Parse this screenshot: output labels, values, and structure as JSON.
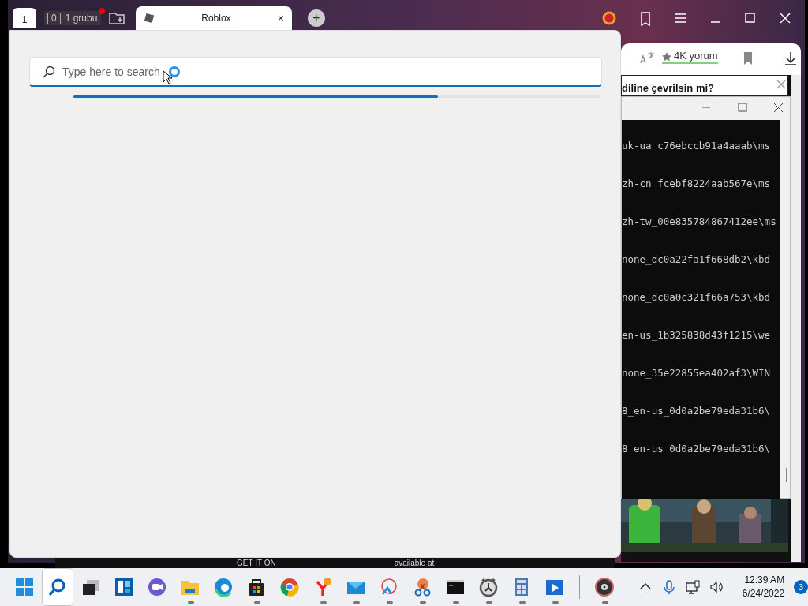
{
  "browser": {
    "home_badge": "1",
    "group_count": "0",
    "group_label": "1 grubu",
    "tabs": [
      {
        "label": "Roblox",
        "selected": true,
        "close": "×"
      }
    ],
    "new_tab": "+",
    "reviews": "4K yorum"
  },
  "translate_popup": {
    "text": "diline çevrilsin mi?"
  },
  "terminal": {
    "lines": [
      "uk-ua_c76ebccb91a4aaab\\ms",
      "zh-cn_fcebf8224aab567e\\ms",
      "zh-tw_00e835784867412ee\\ms",
      "none_dc0a22fa1f668db2\\kbd",
      "none_dc0a0c321f66a753\\kbd",
      "en-us_1b325838d43f1215\\we",
      "none_35e22855ea402af3\\WIN",
      "8_en-us_0d0a2be79eda31b6\\",
      "8_en-us_0d0a2be79eda31b6\\"
    ]
  },
  "search_panel": {
    "placeholder": "Type here to search",
    "progress": {
      "level": 0.69
    }
  },
  "ads": [
    "GET IT ON",
    "available at"
  ],
  "taskbar": {
    "apps": [
      {
        "kind": "start",
        "selected": false,
        "running": false
      },
      {
        "kind": "search",
        "selected": true,
        "running": false
      },
      {
        "kind": "taskview",
        "selected": false,
        "running": false
      },
      {
        "kind": "widgets",
        "selected": false,
        "running": false
      },
      {
        "kind": "chat",
        "selected": false,
        "running": false
      },
      {
        "kind": "explorer",
        "selected": false,
        "running": true
      },
      {
        "kind": "edge",
        "selected": false,
        "running": false
      },
      {
        "kind": "store",
        "selected": false,
        "running": true
      },
      {
        "kind": "chrome",
        "selected": false,
        "running": false
      },
      {
        "kind": "yandex",
        "selected": false,
        "running": true
      },
      {
        "kind": "mail",
        "selected": false,
        "running": true
      },
      {
        "kind": "paint",
        "selected": false,
        "running": true
      },
      {
        "kind": "snip",
        "selected": false,
        "running": true
      },
      {
        "kind": "terminal",
        "selected": false,
        "running": true
      },
      {
        "kind": "clock",
        "selected": false,
        "running": true
      },
      {
        "kind": "calculator",
        "selected": false,
        "running": true
      },
      {
        "kind": "media",
        "selected": false,
        "running": true
      },
      {
        "kind": "separator"
      },
      {
        "kind": "music",
        "selected": false,
        "running": true
      }
    ],
    "time": "12:39 AM",
    "date": "6/24/2022",
    "notifications": "3"
  }
}
